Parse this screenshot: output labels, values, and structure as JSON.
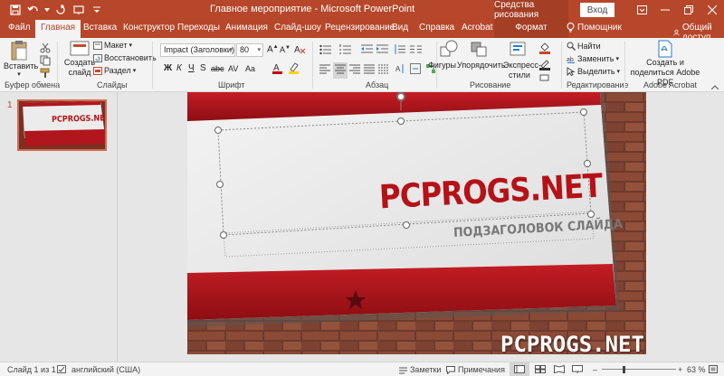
{
  "window": {
    "title": "Главное мероприятие - Microsoft PowerPoint",
    "context_tools": "Средства рисования",
    "signin": "Вход"
  },
  "tabs": [
    "Файл",
    "Главная",
    "Вставка",
    "Конструктор",
    "Переходы",
    "Анимация",
    "Слайд-шоу",
    "Рецензирование",
    "Вид",
    "Справка",
    "Acrobat",
    "Формат"
  ],
  "tellme": "Помощник",
  "share": "Общий доступ",
  "ribbon": {
    "clipboard": {
      "paste": "Вставить",
      "label": "Буфер обмена"
    },
    "slides": {
      "new_slide": "Создать слайд",
      "layout": "Макет",
      "reset": "Восстановить",
      "section": "Раздел",
      "label": "Слайды"
    },
    "font": {
      "font_name": "Impact (Заголовки)",
      "font_size": "80",
      "bold": "Ж",
      "italic": "К",
      "underline": "Ч",
      "strike": "S",
      "shadow": "abc",
      "char_spacing": "AV",
      "case": "Aa",
      "label": "Шрифт"
    },
    "paragraph": {
      "label": "Абзац"
    },
    "drawing": {
      "shapes": "Фигуры",
      "arrange": "Упорядочить",
      "quick_styles": "Экспресс-стили",
      "label": "Рисование"
    },
    "editing": {
      "find": "Найти",
      "replace": "Заменить",
      "select": "Выделить",
      "label": "Редактирование"
    },
    "acrobat": {
      "create_share": "Создать и поделиться Adobe PDF",
      "label": "Adobe Acrobat"
    }
  },
  "thumbnails": [
    {
      "number": "1",
      "title": "PCPROGS.NET"
    }
  ],
  "slide": {
    "title": "PCPROGS.NET",
    "subtitle": "ПОДЗАГОЛОВОК СЛАЙДА"
  },
  "statusbar": {
    "slide_info": "Слайд 1 из 1",
    "language": "английский (США)",
    "notes": "Заметки",
    "comments": "Примечания",
    "zoom": "63 %",
    "zoom_percent": 63
  },
  "watermark": "PCPROGS.NET",
  "colors": {
    "accent": "#b7472a",
    "context": "#a43e25",
    "slide_red": "#a8151b"
  }
}
